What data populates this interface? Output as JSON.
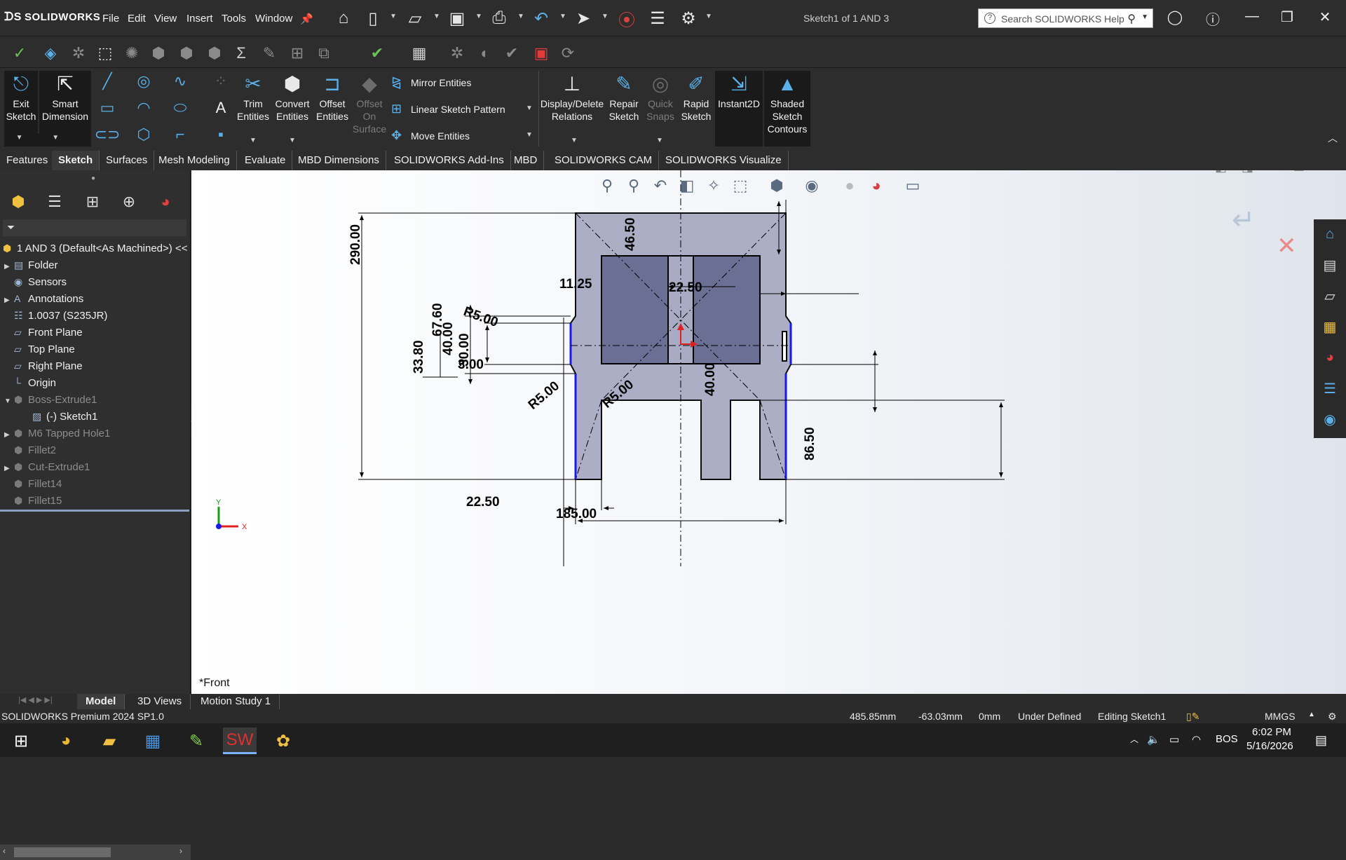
{
  "app": {
    "logo": "SOLIDWORKS",
    "doc_title": "Sketch1 of 1 AND 3"
  },
  "menu": [
    "File",
    "Edit",
    "View",
    "Insert",
    "Tools",
    "Window"
  ],
  "search": {
    "placeholder": "Search SOLIDWORKS Help"
  },
  "ribbon": {
    "exit_sketch": "Exit Sketch",
    "smart_dimension": "Smart Dimension",
    "trim": "Trim Entities",
    "convert": "Convert Entities",
    "offset": "Offset Entities",
    "offset_surface": "Offset On Surface",
    "mirror": "Mirror Entities",
    "linear_pattern": "Linear Sketch Pattern",
    "move": "Move Entities",
    "display_relations": "Display/Delete Relations",
    "repair": "Repair Sketch",
    "quick_snaps": "Quick Snaps",
    "rapid": "Rapid Sketch",
    "instant2d": "Instant2D",
    "shaded": "Shaded Sketch Contours"
  },
  "tabs": [
    "Features",
    "Sketch",
    "Surfaces",
    "Mesh Modeling",
    "Evaluate",
    "MBD Dimensions",
    "SOLIDWORKS Add-Ins",
    "MBD",
    "SOLIDWORKS CAM",
    "SOLIDWORKS Visualize"
  ],
  "active_tab": "Sketch",
  "tree": {
    "root": "1 AND 3  (Default<As Machined>) <<",
    "items": [
      {
        "label": "Folder",
        "icon": "folder-icon"
      },
      {
        "label": "Sensors",
        "icon": "sensor-icon"
      },
      {
        "label": "Annotations",
        "icon": "annotation-icon"
      },
      {
        "label": "1.0037 (S235JR)",
        "icon": "material-icon"
      },
      {
        "label": "Front Plane",
        "icon": "plane-icon"
      },
      {
        "label": "Top Plane",
        "icon": "plane-icon"
      },
      {
        "label": "Right Plane",
        "icon": "plane-icon"
      },
      {
        "label": "Origin",
        "icon": "origin-icon"
      },
      {
        "label": "Boss-Extrude1",
        "icon": "extrude-icon"
      },
      {
        "label": "(-) Sketch1",
        "icon": "sketch-icon"
      },
      {
        "label": "M6 Tapped Hole1",
        "icon": "hole-icon"
      },
      {
        "label": "Fillet2",
        "icon": "fillet-icon"
      },
      {
        "label": "Cut-Extrude1",
        "icon": "cut-icon"
      },
      {
        "label": "Fillet14",
        "icon": "fillet-icon"
      },
      {
        "label": "Fillet15",
        "icon": "fillet-icon"
      }
    ]
  },
  "dims": {
    "d290": "290.00",
    "d46_50": "46.50",
    "d11_25": "11.25",
    "d22_50_right": "22.50",
    "r5_top": "R5.00",
    "d67_60": "67.60",
    "d40_left": "40.00",
    "d33_80": "33.80",
    "d30_00": "30.00",
    "d3_00": "3.00",
    "r5_mid_left": "R5.00",
    "r5_mid_right": "R5.00",
    "d40_right": "40.00",
    "d86_50": "86.50",
    "d22_50_bottom": "22.50",
    "d185": "185.00"
  },
  "axes": {
    "x": "X",
    "y": "Y"
  },
  "view_name": "*Front",
  "bottom_tabs": [
    "Model",
    "3D Views",
    "Motion Study 1"
  ],
  "status": {
    "product": "SOLIDWORKS Premium 2024 SP1.0",
    "x": "485.85mm",
    "y": "-63.03mm",
    "z": "0mm",
    "state": "Under Defined",
    "editing": "Editing Sketch1",
    "units": "MMGS"
  },
  "taskbar": {
    "lang": "BOS",
    "time": "6:02 PM",
    "date": "5/16/2026"
  }
}
